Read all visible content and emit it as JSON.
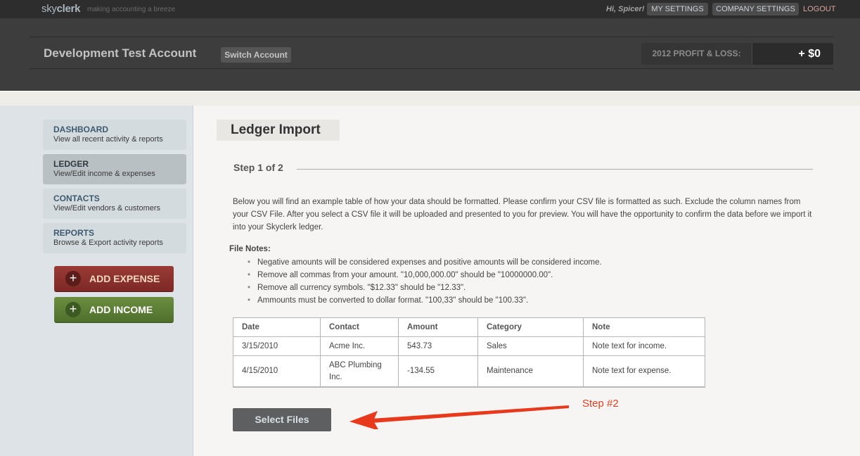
{
  "topbar": {
    "logo_light": "sky",
    "logo_bold": "clerk",
    "tagline": "making accounting a breeze",
    "greeting": "Hi, Spicer!",
    "my_settings": "MY SETTINGS",
    "company_settings": "COMPANY SETTINGS",
    "logout": "LOGOUT"
  },
  "header": {
    "account_name": "Development Test Account",
    "switch_account": "Switch Account",
    "pl_label": "2012 PROFIT & LOSS:",
    "pl_value": "+ $0"
  },
  "sidebar": {
    "items": [
      {
        "title": "DASHBOARD",
        "subtitle": "View all recent activity & reports",
        "active": false
      },
      {
        "title": "LEDGER",
        "subtitle": "View/Edit income & expenses",
        "active": true
      },
      {
        "title": "CONTACTS",
        "subtitle": "View/Edit vendors & customers",
        "active": false
      },
      {
        "title": "REPORTS",
        "subtitle": "Browse & Export activity reports",
        "active": false
      }
    ],
    "add_expense": "ADD EXPENSE",
    "add_income": "ADD INCOME",
    "plus_icon": "+",
    "colors": {
      "expense": "#8b312d",
      "income": "#5d7f36"
    }
  },
  "main": {
    "page_title": "Ledger Import",
    "step": "Step 1 of 2",
    "intro": "Below you will find an example table of how your data should be formatted. Please confirm your CSV file is formatted as such. Exclude the column names from your CSV File. After you select a CSV file it will be uploaded and presented to you for preview. You will have the opportunity to confirm the data before we import it into your Skyclerk ledger.",
    "notes_title": "File Notes:",
    "notes": [
      "Negative amounts will be considered expenses and positive amounts will be considered income.",
      "Remove all commas from your amount. \"10,000,000.00\" should be \"10000000.00\".",
      "Remove all currency symbols. \"$12.33\" should be \"12.33\".",
      "Ammounts must be converted to dollar format. \"100,33\" should be \"100.33\"."
    ],
    "table": {
      "headers": [
        "Date",
        "Contact",
        "Amount",
        "Category",
        "Note"
      ],
      "rows": [
        [
          "3/15/2010",
          "Acme Inc.",
          "543.73",
          "Sales",
          "Note text for income."
        ],
        [
          "4/15/2010",
          "ABC Plumbing Inc.",
          "-134.55",
          "Maintenance",
          "Note text for expense."
        ]
      ]
    },
    "select_files": "Select Files"
  },
  "annotation": {
    "label": "Step #2",
    "color": "#e53a1d"
  }
}
